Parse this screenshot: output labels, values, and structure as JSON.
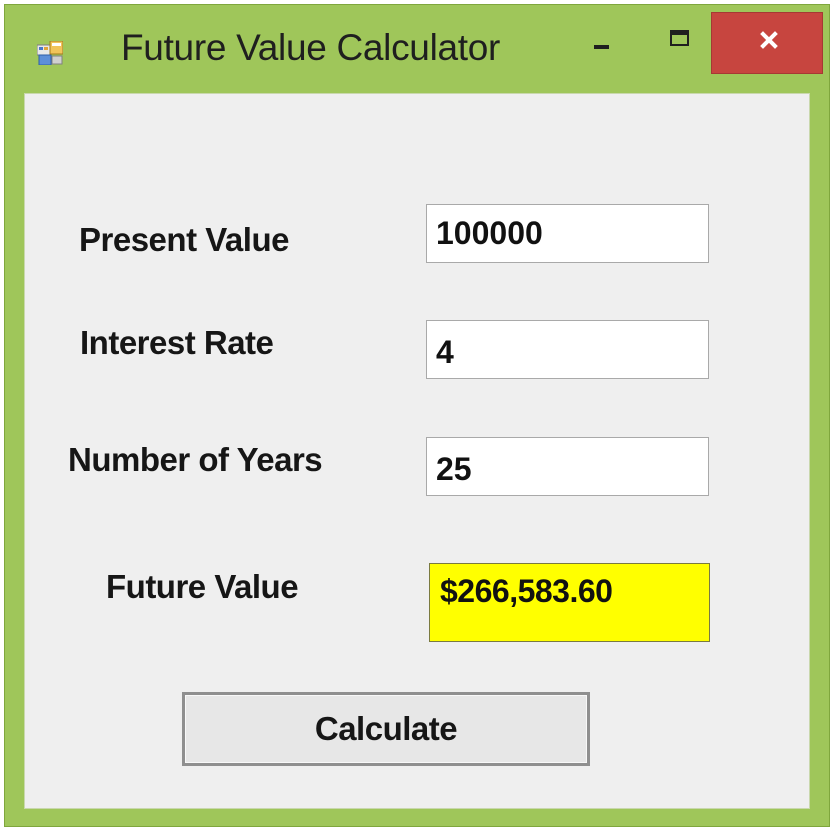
{
  "window": {
    "title": "Future Value Calculator",
    "app_icon": "windows-form-icon",
    "controls": {
      "minimize_icon": "minimize-icon",
      "maximize_icon": "maximize-icon",
      "close_icon": "close-icon",
      "close_color": "#c7453f"
    },
    "frame_color": "#9fc65a"
  },
  "form": {
    "present_value": {
      "label": "Present Value",
      "value": "100000"
    },
    "interest_rate": {
      "label": "Interest Rate",
      "value": "4"
    },
    "number_of_years": {
      "label": "Number of Years",
      "value": "25"
    },
    "future_value": {
      "label": "Future Value",
      "value": "$266,583.60",
      "highlight_color": "#ffff00"
    },
    "calculate_label": "Calculate"
  }
}
